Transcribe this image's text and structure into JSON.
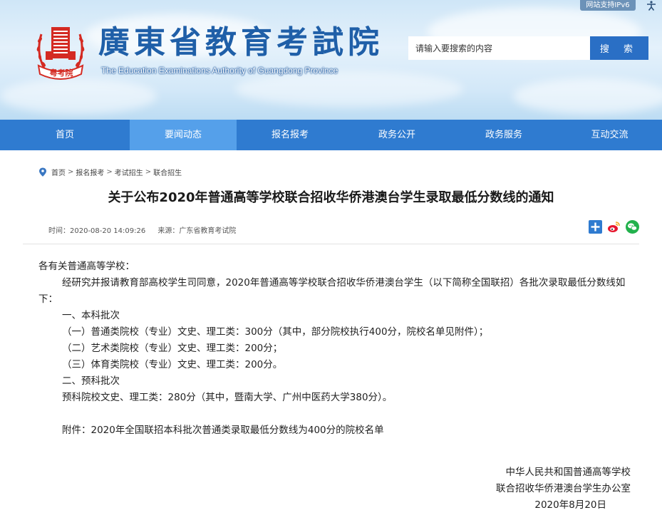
{
  "header": {
    "ipv6_badge": "网站支持IPv6",
    "site_title": "廣東省教育考試院",
    "site_subtitle": "The Education Examinations Authority of Guangdong Province",
    "logo_text": "粤考院",
    "search": {
      "placeholder": "请输入要搜索的内容",
      "button_label": "搜 索"
    }
  },
  "nav": {
    "items": [
      {
        "label": "首页"
      },
      {
        "label": "要闻动态"
      },
      {
        "label": "报名报考"
      },
      {
        "label": "政务公开"
      },
      {
        "label": "政务服务"
      },
      {
        "label": "互动交流"
      }
    ],
    "active_index": 1
  },
  "breadcrumb": [
    "首页",
    "报名报考",
    "考试招生",
    "联合招生"
  ],
  "article": {
    "title": "关于公布2020年普通高等学校联合招收华侨港澳台学生录取最低分数线的通知",
    "time": "时间：2020-08-20 14:09:26",
    "source": "来源：广东省教育考试院",
    "salutation": "各有关普通高等学校：",
    "intro": "经研究并报请教育部高校学生司同意，2020年普通高等学校联合招收华侨港澳台学生（以下简称全国联招）各批次录取最低分数线如下：",
    "section1_title": "一、本科批次",
    "section1_items": [
      "（一）普通类院校（专业）文史、理工类：300分（其中，部分院校执行400分，院校名单见附件）；",
      "（二）艺术类院校（专业）文史、理工类：200分；",
      "（三）体育类院校（专业）文史、理工类：200分。"
    ],
    "section2_title": "二、预科批次",
    "section2_text": "预科院校文史、理工类：280分（其中，暨南大学、广州中医药大学380分）。",
    "attachment": "附件：2020年全国联招本科批次普通类录取最低分数线为400分的院校名单",
    "signature": {
      "line1": "中华人民共和国普通高等学校",
      "line2": "联合招收华侨港澳台学生办公室",
      "date": "2020年8月20日"
    }
  },
  "colors": {
    "nav_bg": "#2f7bd0",
    "nav_active": "#55a0ea",
    "title_blue": "#1f5fa8",
    "search_button": "#2a6fc5",
    "logo_red": "#d42a22"
  }
}
